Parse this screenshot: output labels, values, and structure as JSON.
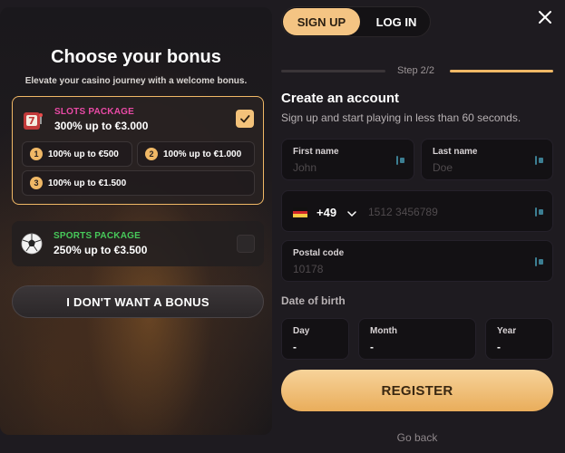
{
  "bonus": {
    "title": "Choose your bonus",
    "subtitle": "Elevate your casino journey with a welcome bonus.",
    "slots": {
      "name": "SLOTS PACKAGE",
      "amount": "300% up to €3.000",
      "name_color": "#e94aa6",
      "selected": true,
      "tiers": [
        {
          "num": "1",
          "text": "100% up to €500"
        },
        {
          "num": "2",
          "text": "100% up to €1.000"
        },
        {
          "num": "3",
          "text": "100% up to €1.500"
        }
      ]
    },
    "sports": {
      "name": "SPORTS PACKAGE",
      "amount": "250% up to €3.500",
      "name_color": "#47c95a",
      "selected": false
    },
    "no_bonus_label": "I DON'T WANT A BONUS"
  },
  "tabs": {
    "signup": "SIGN UP",
    "login": "LOG IN"
  },
  "step": {
    "text": "Step 2/2"
  },
  "form": {
    "title": "Create an account",
    "subtitle": "Sign up and start playing in less than 60 seconds.",
    "first_name": {
      "label": "First name",
      "placeholder": "John"
    },
    "last_name": {
      "label": "Last name",
      "placeholder": "Doe"
    },
    "phone": {
      "country_code": "+49",
      "placeholder": "1512 3456789"
    },
    "postal": {
      "label": "Postal code",
      "placeholder": "10178"
    },
    "dob": {
      "label": "Date of birth",
      "day": {
        "label": "Day",
        "value": "-"
      },
      "month": {
        "label": "Month",
        "value": "-"
      },
      "year": {
        "label": "Year",
        "value": "-"
      }
    },
    "register_label": "REGISTER",
    "go_back_label": "Go back"
  },
  "colors": {
    "accent": "#f4c483",
    "background": "#1e1b20"
  }
}
